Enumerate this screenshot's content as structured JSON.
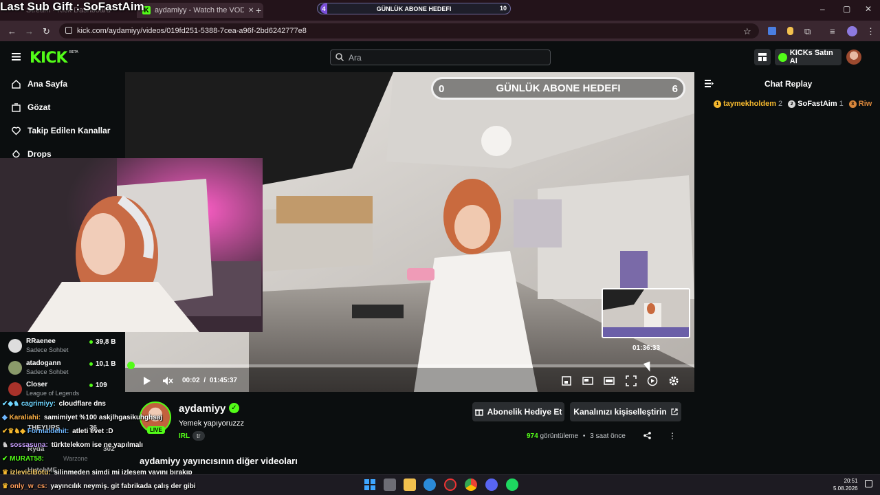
{
  "overlay": {
    "last_sub_gift": "Last Sub Gift : SoFastAim"
  },
  "browser": {
    "tabs": [
      {
        "label": "Stream - Kick Dashboard"
      },
      {
        "label": "aydamiyy - Watch the VOD on Kick"
      }
    ],
    "goal_pill": {
      "left": "4",
      "label": "GÜNLÜK ABONE HEDEFI",
      "right": "10"
    },
    "url": "kick.com/aydamiyy/videos/019fd251-5388-7cea-a96f-2bd6242777e8",
    "window_controls": [
      "–",
      "▢",
      "✕"
    ]
  },
  "header": {
    "logo": "KICK",
    "logo_badge": "BETA",
    "search_placeholder": "Ara",
    "kicks_button": "KICKs Satın Al"
  },
  "sidebar": {
    "items": [
      {
        "label": "Ana Sayfa",
        "icon": "home-icon"
      },
      {
        "label": "Gözat",
        "icon": "browse-icon"
      },
      {
        "label": "Takip Edilen Kanallar",
        "icon": "heart-icon"
      },
      {
        "label": "Drops",
        "icon": "drops-icon"
      }
    ],
    "channels": [
      {
        "name": "RRaenee",
        "category": "Sadece Sohbet",
        "viewers": "39,8 B"
      },
      {
        "name": "atadogann",
        "category": "Sadece Sohbet",
        "viewers": "10,1 B"
      },
      {
        "name": "Closer",
        "category": "League of Legends",
        "viewers": "109"
      }
    ]
  },
  "video": {
    "goal_overlay": {
      "left": "0",
      "label": "GÜNLÜK ABONE HEDEFI",
      "right": "6"
    },
    "preview_time": "01:36:33",
    "current_time": "00:02",
    "duration": "01:45:37",
    "progress_fraction": 0.0003
  },
  "chat": {
    "title": "Chat Replay",
    "gifters": [
      {
        "rank": "1",
        "name": "taymekholdem",
        "count": "2",
        "color": "#f5b82e"
      },
      {
        "rank": "2",
        "name": "SoFastAim",
        "count": "1",
        "color": "#d6d6d6"
      },
      {
        "rank": "3",
        "name": "Riw",
        "count": "",
        "color": "#d8863b"
      }
    ]
  },
  "channel": {
    "name": "aydamiyy",
    "live_badge": "LIVE",
    "stream_title": "Yemek yapıyoruzzz",
    "category": "IRL",
    "language": "tr",
    "gift_button": "Abonelik Hediye Et",
    "customize_button": "Kanalınızı kişiselleştirin",
    "views": "974",
    "views_label": "görüntüleme",
    "age": "3 saat önce",
    "other_videos": "aydamiyy yayıncısının diğer videoları"
  },
  "chat_overlay": [
    {
      "user": "cagrimiyy:",
      "text": "cloudflare dns",
      "color": "#6fd6ff"
    },
    {
      "user": "Karaliahi:",
      "text": "samimiyet %100 askjlhgasikuhghsaj",
      "color": "#ffb347"
    },
    {
      "user": "Formaldehit:",
      "text": "atleti evet :D",
      "color": "#6fb8ff"
    },
    {
      "user": "sossasuna:",
      "text": "türktelekom ise ne yapılmalı",
      "color": "#c9a0ff"
    },
    {
      "user": "MURAT58:",
      "text": "",
      "color": "#53fc18"
    },
    {
      "user": "izleyiciBotu:",
      "text": "silinmeden şimdi mi izlesem yayını bırakıp",
      "color": "#ffd36b"
    },
    {
      "user": "only_w_cs:",
      "text": "yayıncılık neymiş. git fabrikada çalış der gibi",
      "color": "#ff9d5c"
    }
  ],
  "overlay_residue": [
    {
      "name": "THEYUPS",
      "viewers": "36"
    },
    {
      "name": "Ryda",
      "category": "Warzone",
      "viewers": "302"
    },
    {
      "name": "HutchMF"
    }
  ],
  "taskbar": {
    "time": "20:51",
    "date": "5.08.2026"
  }
}
